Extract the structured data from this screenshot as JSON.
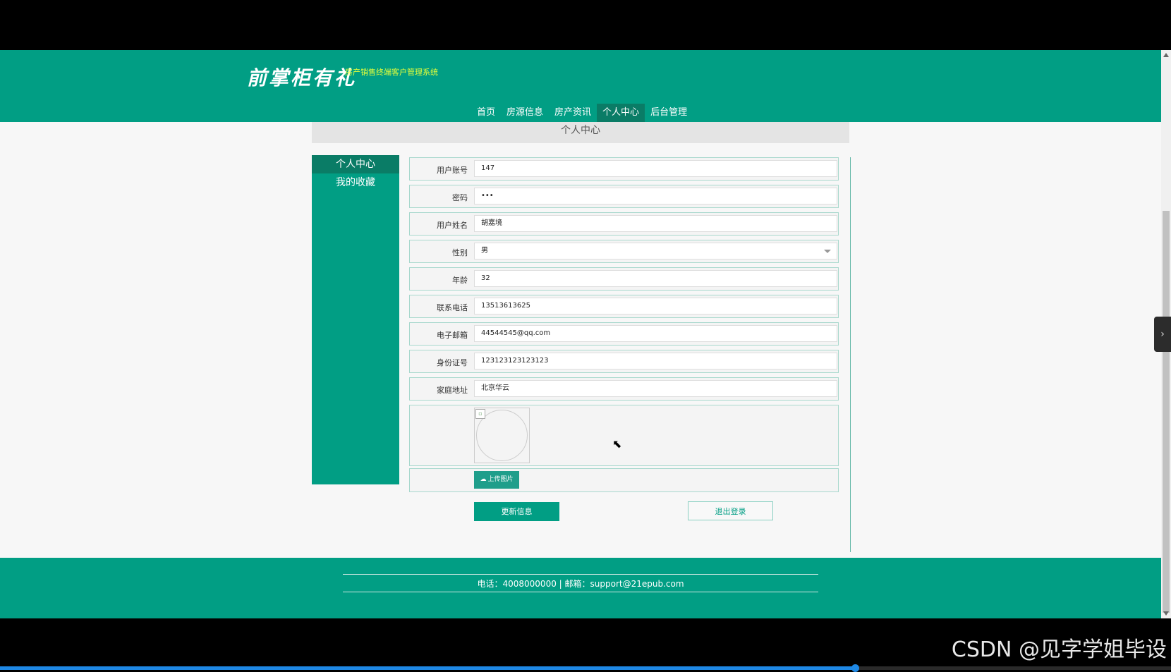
{
  "header": {
    "logo_text": "前掌柜有礼",
    "subtitle": "房产销售终端客户管理系统"
  },
  "nav": {
    "items": [
      {
        "label": "首页"
      },
      {
        "label": "房源信息"
      },
      {
        "label": "房产资讯"
      },
      {
        "label": "个人中心",
        "active": true
      },
      {
        "label": "后台管理"
      }
    ]
  },
  "page_title": "个人中心",
  "sidebar": {
    "items": [
      {
        "label": "个人中心",
        "active": true
      },
      {
        "label": "我的收藏"
      }
    ]
  },
  "form": {
    "fields": [
      {
        "label": "用户账号",
        "value": "147"
      },
      {
        "label": "密码",
        "value": "•••"
      },
      {
        "label": "用户姓名",
        "value": "胡嘉境"
      },
      {
        "label": "性别",
        "value": "男"
      },
      {
        "label": "年龄",
        "value": "32"
      },
      {
        "label": "联系电话",
        "value": "13513613625"
      },
      {
        "label": "电子邮箱",
        "value": "44544545@qq.com"
      },
      {
        "label": "身份证号",
        "value": "123123123123123"
      },
      {
        "label": "家庭地址",
        "value": "北京华云"
      }
    ],
    "upload_label": "上传图片",
    "update_label": "更新信息",
    "logout_label": "退出登录"
  },
  "footer": {
    "text": "电话：4008000000 | 邮箱：support@21epub.com"
  },
  "watermark": "CSDN @见字学姐毕设",
  "video_progress": 0.73,
  "colors": {
    "primary": "#019e84",
    "active": "#0a7c66",
    "subtitle": "#e6ff3a"
  }
}
